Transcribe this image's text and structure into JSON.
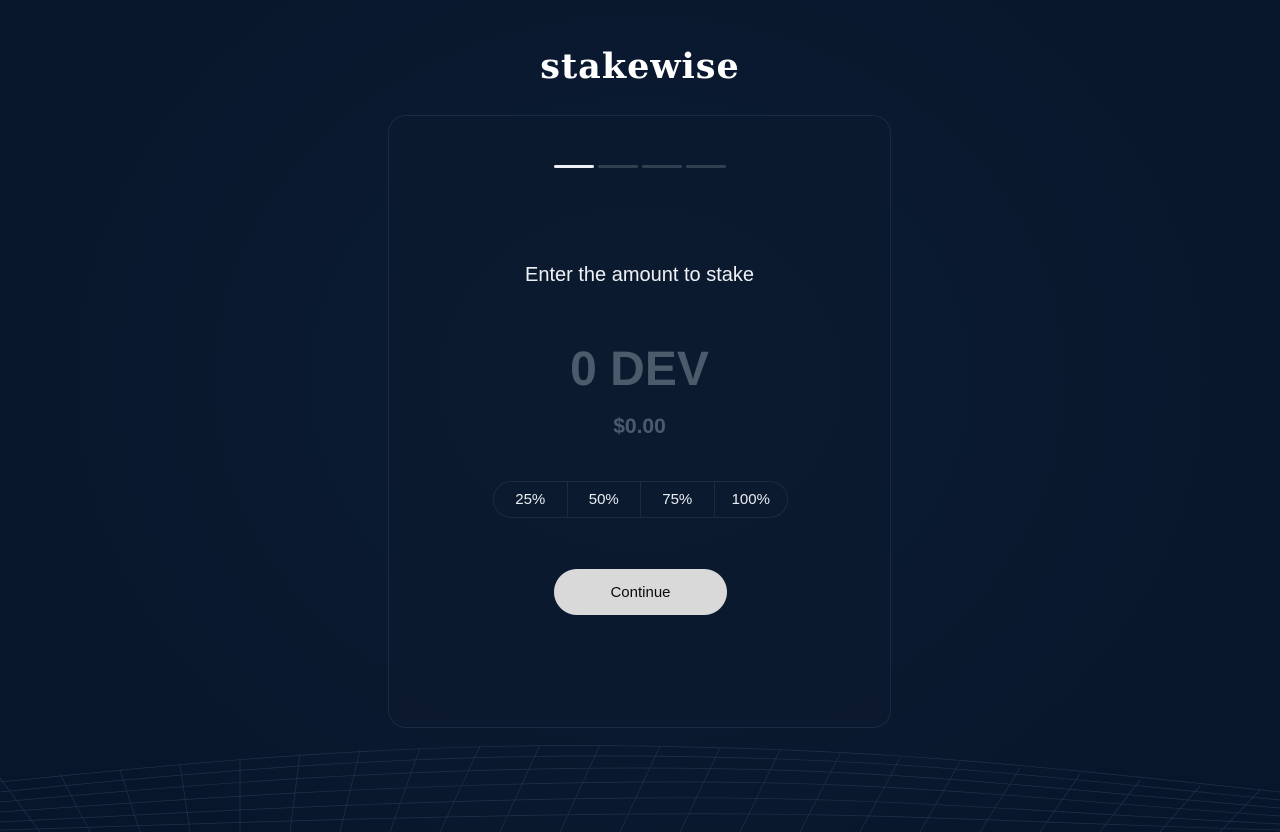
{
  "brand": {
    "logo_text": "stakewise"
  },
  "stepper": {
    "total_steps": 4,
    "current_step": 1
  },
  "stake": {
    "prompt": "Enter the amount to stake",
    "amount_display": "0 DEV",
    "fiat_display": "$0.00"
  },
  "percent_options": [
    "25%",
    "50%",
    "75%",
    "100%"
  ],
  "actions": {
    "continue_label": "Continue"
  },
  "colors": {
    "background": "#09182e",
    "card_border": "#1a2a40",
    "muted_text": "#4d5a6b",
    "button_bg": "#d9d9d9"
  }
}
